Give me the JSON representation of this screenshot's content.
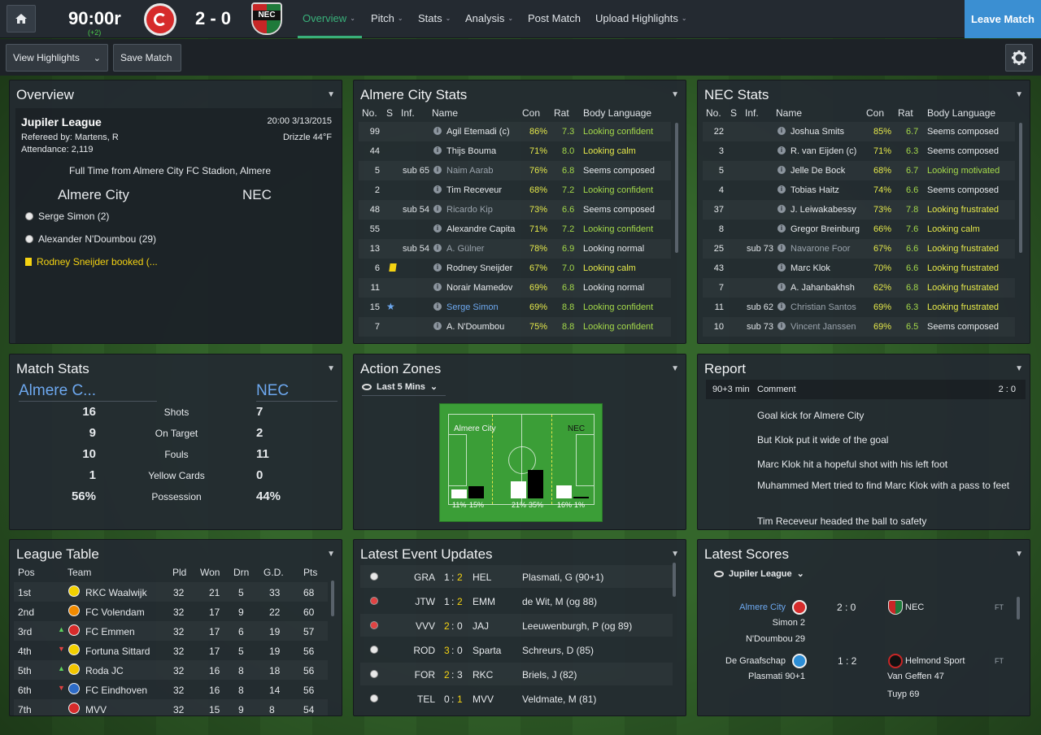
{
  "top": {
    "clock": "90:00r",
    "added": "(+2)",
    "score": "2 - 0",
    "leave": "Leave Match",
    "nav": [
      {
        "label": "Overview",
        "caret": true
      },
      {
        "label": "Pitch",
        "caret": true
      },
      {
        "label": "Stats",
        "caret": true
      },
      {
        "label": "Analysis",
        "caret": true
      },
      {
        "label": "Post Match",
        "caret": false
      },
      {
        "label": "Upload Highlights",
        "caret": true
      }
    ]
  },
  "sub": {
    "view": "View Highlights",
    "save": "Save Match"
  },
  "overview": {
    "title": "Overview",
    "league": "Jupiler League",
    "datetime": "20:00 3/13/2015",
    "referee": "Refereed by: Martens, R",
    "weather": "Drizzle 44°F",
    "attendance": "Attendance: 2,119",
    "result": "Full Time from Almere City FC Stadion, Almere",
    "home": "Almere City",
    "away": "NEC",
    "events": [
      {
        "text": "Serge Simon (2)",
        "type": "goal"
      },
      {
        "text": "Alexander N'Doumbou (29)",
        "type": "goal"
      },
      {
        "text": "Rodney Sneijder booked (...",
        "type": "card"
      }
    ]
  },
  "almere": {
    "title": "Almere City Stats",
    "headers": [
      "No.",
      "S",
      "Inf.",
      "Name",
      "Con",
      "Rat",
      "Body Language"
    ],
    "rows": [
      {
        "no": "99",
        "inf": "",
        "name": "Agil Etemadi (c)",
        "con": "86%",
        "rat": "7.3",
        "bl": "Looking confident"
      },
      {
        "no": "44",
        "inf": "",
        "name": "Thijs Bouma",
        "con": "71%",
        "rat": "8.0",
        "bl": "Looking calm"
      },
      {
        "no": "5",
        "inf": "sub 65",
        "name": "Naim Aarab",
        "con": "76%",
        "rat": "6.8",
        "bl": "Seems composed"
      },
      {
        "no": "2",
        "inf": "",
        "name": "Tim Receveur",
        "con": "68%",
        "rat": "7.2",
        "bl": "Looking confident"
      },
      {
        "no": "48",
        "inf": "sub 54",
        "name": "Ricardo Kip",
        "con": "73%",
        "rat": "6.6",
        "bl": "Seems composed"
      },
      {
        "no": "55",
        "inf": "",
        "name": "Alexandre Capita",
        "con": "71%",
        "rat": "7.2",
        "bl": "Looking confident"
      },
      {
        "no": "13",
        "inf": "sub 54",
        "name": "A. Gülner",
        "con": "78%",
        "rat": "6.9",
        "bl": "Looking normal"
      },
      {
        "no": "6",
        "inf": "",
        "name": "Rodney Sneijder",
        "con": "67%",
        "rat": "7.0",
        "bl": "Looking calm"
      },
      {
        "no": "11",
        "inf": "",
        "name": "Norair Mamedov",
        "con": "69%",
        "rat": "6.8",
        "bl": "Looking normal"
      },
      {
        "no": "15",
        "inf": "",
        "name": "Serge Simon",
        "con": "69%",
        "rat": "8.8",
        "bl": "Looking confident"
      },
      {
        "no": "7",
        "inf": "",
        "name": "A. N'Doumbou",
        "con": "75%",
        "rat": "8.8",
        "bl": "Looking confident"
      }
    ]
  },
  "nec": {
    "title": "NEC Stats",
    "headers": [
      "No.",
      "S",
      "Inf.",
      "Name",
      "Con",
      "Rat",
      "Body Language"
    ],
    "rows": [
      {
        "no": "22",
        "inf": "",
        "name": "Joshua Smits",
        "con": "85%",
        "rat": "6.7",
        "bl": "Seems composed"
      },
      {
        "no": "3",
        "inf": "",
        "name": "R. van Eijden (c)",
        "con": "71%",
        "rat": "6.3",
        "bl": "Seems composed"
      },
      {
        "no": "5",
        "inf": "",
        "name": "Jelle De Bock",
        "con": "68%",
        "rat": "6.7",
        "bl": "Looking motivated"
      },
      {
        "no": "4",
        "inf": "",
        "name": "Tobias Haitz",
        "con": "74%",
        "rat": "6.6",
        "bl": "Seems composed"
      },
      {
        "no": "37",
        "inf": "",
        "name": "J. Leiwakabessy",
        "con": "73%",
        "rat": "7.8",
        "bl": "Looking frustrated"
      },
      {
        "no": "8",
        "inf": "",
        "name": "Gregor Breinburg",
        "con": "66%",
        "rat": "7.6",
        "bl": "Looking calm"
      },
      {
        "no": "25",
        "inf": "sub 73",
        "name": "Navarone Foor",
        "con": "67%",
        "rat": "6.6",
        "bl": "Looking frustrated"
      },
      {
        "no": "43",
        "inf": "",
        "name": "Marc Klok",
        "con": "70%",
        "rat": "6.6",
        "bl": "Looking frustrated"
      },
      {
        "no": "7",
        "inf": "",
        "name": "A. Jahanbakhsh",
        "con": "62%",
        "rat": "6.8",
        "bl": "Looking frustrated"
      },
      {
        "no": "11",
        "inf": "sub 62",
        "name": "Christian Santos",
        "con": "69%",
        "rat": "6.3",
        "bl": "Looking frustrated"
      },
      {
        "no": "10",
        "inf": "sub 73",
        "name": "Vincent Janssen",
        "con": "69%",
        "rat": "6.5",
        "bl": "Seems composed"
      }
    ]
  },
  "matchstats": {
    "title": "Match Stats",
    "home": "Almere C...",
    "away": "NEC",
    "rows": [
      {
        "h": "16",
        "label": "Shots",
        "a": "7"
      },
      {
        "h": "9",
        "label": "On Target",
        "a": "2"
      },
      {
        "h": "10",
        "label": "Fouls",
        "a": "11"
      },
      {
        "h": "1",
        "label": "Yellow Cards",
        "a": "0"
      },
      {
        "h": "56%",
        "label": "Possession",
        "a": "44%"
      }
    ]
  },
  "action": {
    "title": "Action Zones",
    "filter": "Last 5 Mins",
    "home": "Almere City",
    "away": "NEC",
    "zones": [
      {
        "home": 11,
        "away": 15,
        "home_label": "11%",
        "away_label": "15%"
      },
      {
        "home": 21,
        "away": 35,
        "home_label": "21%",
        "away_label": "35%"
      },
      {
        "home": 16,
        "away": 1,
        "home_label": "16%",
        "away_label": "1%"
      }
    ]
  },
  "report": {
    "title": "Report",
    "min": "90+3 min",
    "comment": "Comment",
    "score": "2 : 0",
    "lines": [
      "Goal kick for Almere City",
      "But Klok put it wide of the goal",
      "Marc Klok hit a hopeful shot with his left foot",
      "Muhammed Mert tried to find Marc Klok with a pass to feet",
      "Tim Receveur headed the ball to safety"
    ]
  },
  "league": {
    "title": "League Table",
    "headers": [
      "Pos",
      "Team",
      "Pld",
      "Won",
      "Drn",
      "G.D.",
      "Pts"
    ],
    "rows": [
      {
        "pos": "1st",
        "mv": "",
        "team": "RKC Waalwijk",
        "pld": "32",
        "won": "21",
        "drn": "5",
        "gd": "33",
        "pts": "68"
      },
      {
        "pos": "2nd",
        "mv": "",
        "team": "FC Volendam",
        "pld": "32",
        "won": "17",
        "drn": "9",
        "gd": "22",
        "pts": "60"
      },
      {
        "pos": "3rd",
        "mv": "up",
        "team": "FC Emmen",
        "pld": "32",
        "won": "17",
        "drn": "6",
        "gd": "19",
        "pts": "57"
      },
      {
        "pos": "4th",
        "mv": "down",
        "team": "Fortuna Sittard",
        "pld": "32",
        "won": "17",
        "drn": "5",
        "gd": "19",
        "pts": "56"
      },
      {
        "pos": "5th",
        "mv": "up",
        "team": "Roda JC",
        "pld": "32",
        "won": "16",
        "drn": "8",
        "gd": "18",
        "pts": "56"
      },
      {
        "pos": "6th",
        "mv": "down",
        "team": "FC Eindhoven",
        "pld": "32",
        "won": "16",
        "drn": "8",
        "gd": "14",
        "pts": "56"
      },
      {
        "pos": "7th",
        "mv": "",
        "team": "MVV",
        "pld": "32",
        "won": "15",
        "drn": "9",
        "gd": "8",
        "pts": "54"
      }
    ]
  },
  "events": {
    "title": "Latest Event Updates",
    "rows": [
      {
        "type": "ball",
        "home": "GRA",
        "hs": "1",
        "as": "2",
        "hl": "a",
        "away": "HEL",
        "detail": "Plasmati, G (90+1)"
      },
      {
        "type": "og",
        "home": "JTW",
        "hs": "1",
        "as": "2",
        "hl": "a",
        "away": "EMM",
        "detail": "de Wit, M (og 88)"
      },
      {
        "type": "og",
        "home": "VVV",
        "hs": "2",
        "as": "0",
        "hl": "h",
        "away": "JAJ",
        "detail": "Leeuwenburgh, P (og 89)"
      },
      {
        "type": "ball",
        "home": "ROD",
        "hs": "3",
        "as": "0",
        "hl": "h",
        "away": "Sparta",
        "detail": "Schreurs, D (85)"
      },
      {
        "type": "ball",
        "home": "FOR",
        "hs": "2",
        "as": "3",
        "hl": "h",
        "away": "RKC",
        "detail": "Briels, J (82)"
      },
      {
        "type": "ball",
        "home": "TEL",
        "hs": "0",
        "as": "1",
        "hl": "a",
        "away": "MVV",
        "detail": "Veldmate, M (81)"
      }
    ]
  },
  "scores": {
    "title": "Latest Scores",
    "league": "Jupiler League",
    "matches": [
      {
        "home": "Almere City",
        "score": "2 : 0",
        "away": "NEC",
        "status": "FT",
        "home_scorers": [
          "Simon 2",
          "N'Doumbou 29"
        ],
        "away_scorers": []
      },
      {
        "home": "De Graafschap",
        "score": "1 : 2",
        "away": "Helmond Sport",
        "status": "FT",
        "home_scorers": [
          "Plasmati 90+1"
        ],
        "away_scorers": [
          "Van Geffen 47",
          "Tuyp 69"
        ]
      }
    ]
  }
}
